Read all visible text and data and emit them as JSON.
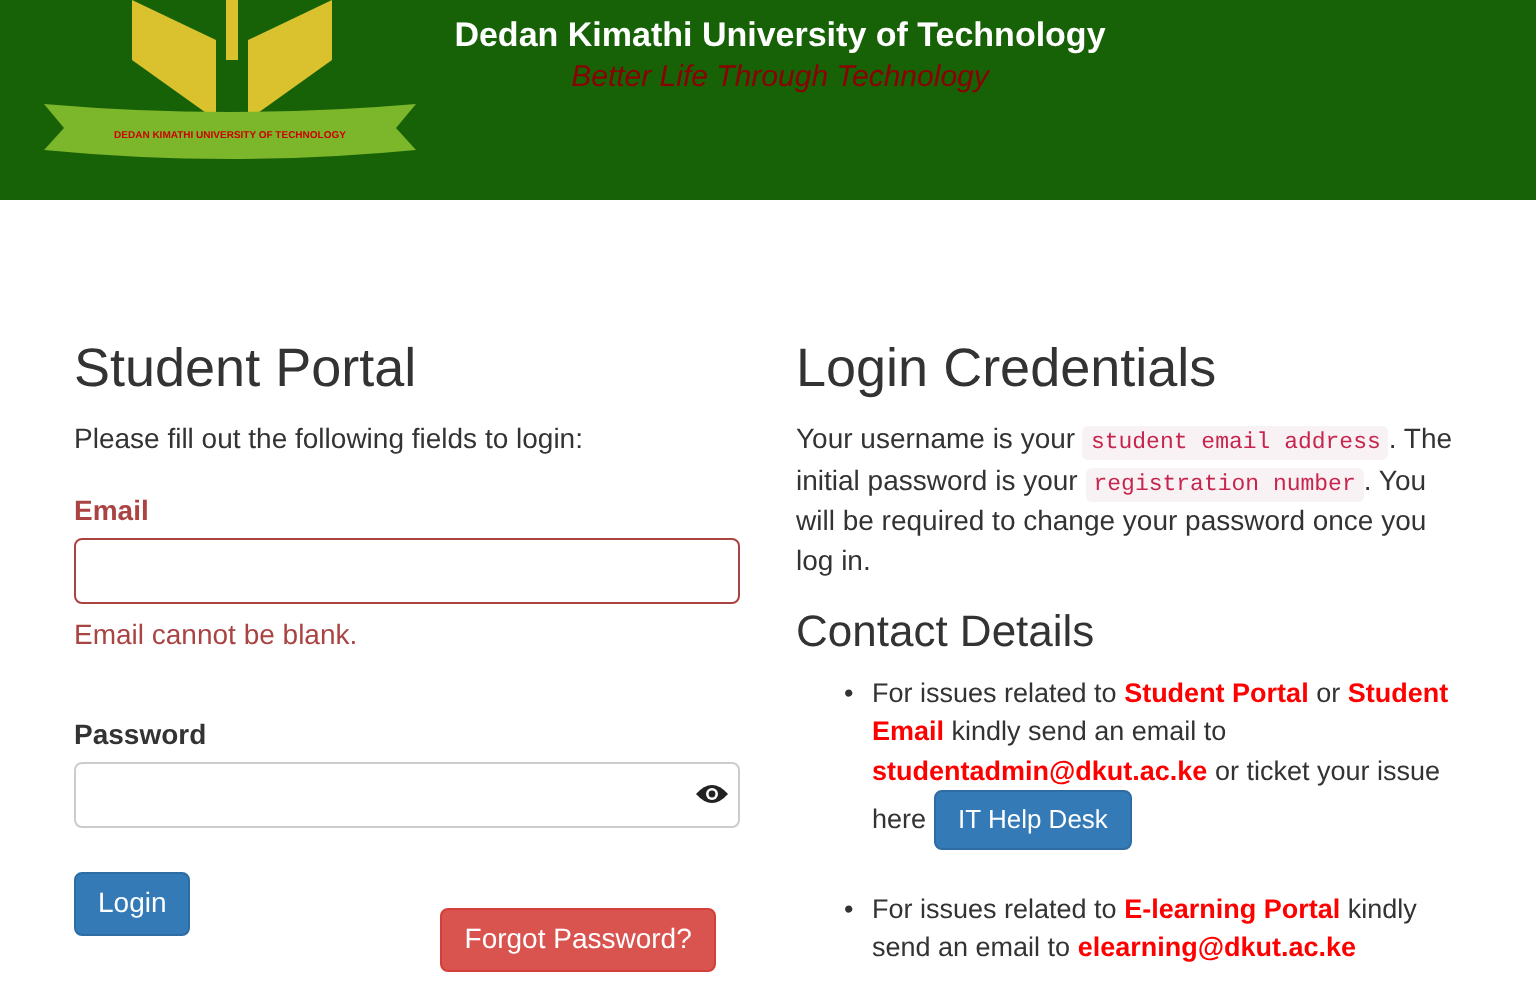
{
  "header": {
    "title": "Dedan Kimathi University of Technology",
    "motto": "Better Life Through Technology",
    "logo_ribbon": "DEDAN KIMATHI UNIVERSITY OF TECHNOLOGY"
  },
  "login": {
    "title": "Student Portal",
    "intro": "Please fill out the following fields to login:",
    "fields": [
      {
        "label": "Email",
        "kind": "text",
        "error": "Email cannot be blank.",
        "invalid": true
      },
      {
        "label": "Password",
        "kind": "password",
        "invalid": false
      }
    ],
    "login_button": "Login",
    "forgot_button": "Forgot Password?"
  },
  "credentials": {
    "title": "Login Credentials",
    "parts": [
      {
        "kind": "text",
        "text": "Your username is your"
      },
      {
        "kind": "code",
        "text": "student email address"
      },
      {
        "kind": "text",
        "text": ". The initial password is your"
      },
      {
        "kind": "code",
        "text": "registration number"
      },
      {
        "kind": "text",
        "text": ". You will be required to change your password once you log in."
      }
    ]
  },
  "contact": {
    "title": "Contact Details",
    "items": [
      {
        "marker": "•",
        "text": "For issues related to **Student Portal** or **Student Email** kindly send an email to **studentadmin@dkut.ac.ke** or ticket your issue",
        "button_lead": "here",
        "button": "IT Help Desk"
      },
      {
        "marker": "•",
        "text": "For issues related to **E-learning Portal** kindly send an email to **elearning@dkut.ac.ke**"
      }
    ]
  }
}
